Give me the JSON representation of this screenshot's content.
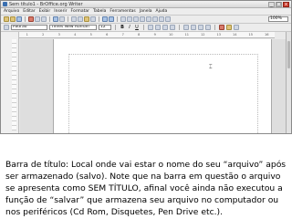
{
  "window": {
    "title": "Sem título1 - BrOffice.org Writer",
    "buttons": {
      "minimize": "_",
      "maximize": "□",
      "close": "x"
    }
  },
  "menu": [
    "Arquivo",
    "Editar",
    "Exibir",
    "Inserir",
    "Formatar",
    "Tabela",
    "Ferramentas",
    "Janela",
    "Ajuda"
  ],
  "toolbar": {
    "zoom": "100%"
  },
  "format": {
    "style": "Padrão",
    "font": "Times New Roman",
    "size": "12"
  },
  "ruler": {
    "ticks": [
      "1",
      "2",
      "3",
      "4",
      "5",
      "6",
      "7",
      "8",
      "9",
      "10",
      "11",
      "12",
      "13",
      "14",
      "15",
      "16"
    ]
  },
  "caption": "Barra de título: Local onde vai estar o nome do seu “arquivo” após ser armazenado (salvo). Note que na barra em questão o arquivo se apresenta como SEM TÍTULO, afinal você ainda não executou a função de “salvar” que armazena seu arquivo no computador ou nos periféricos (Cd Rom, Disquetes, Pen Drive etc.)."
}
